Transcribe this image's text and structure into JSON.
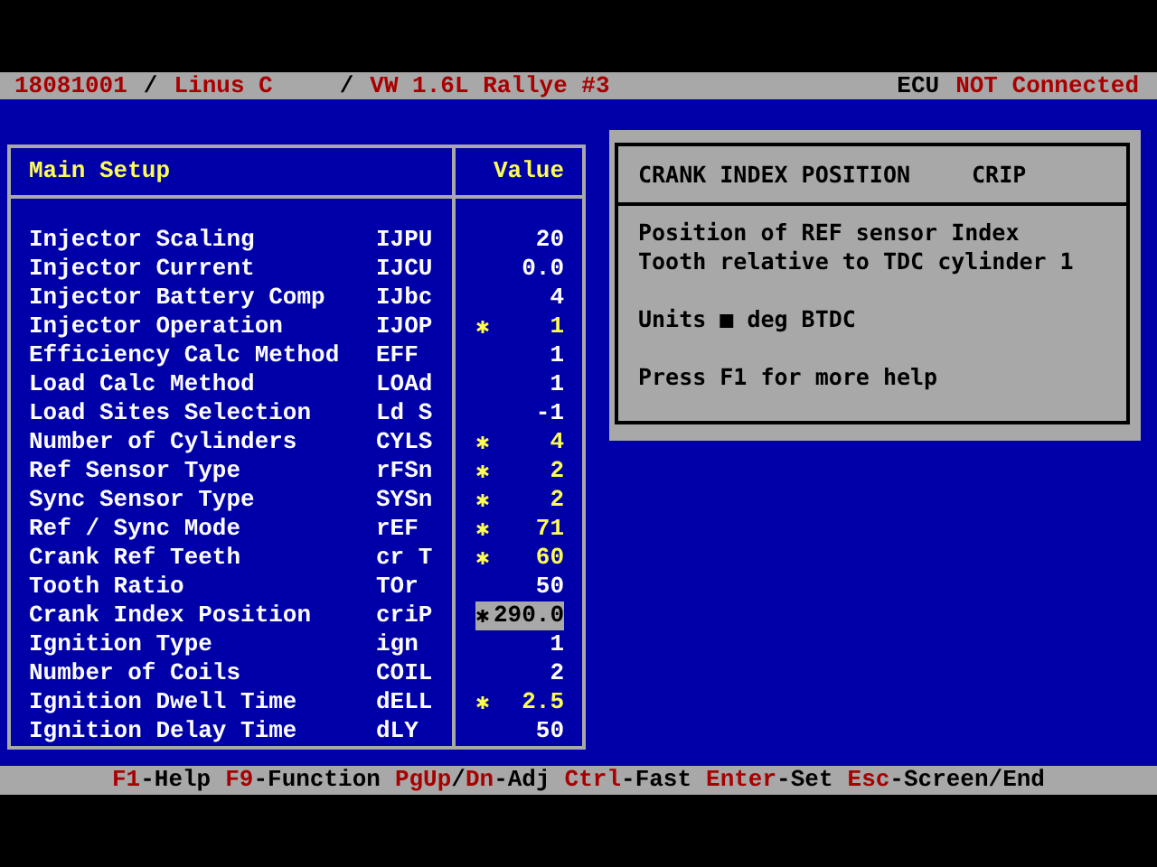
{
  "header": {
    "left": [
      {
        "text": "18081001",
        "kind": "field"
      },
      {
        "text": "/",
        "kind": "sep"
      },
      {
        "text": "Linus C",
        "kind": "field"
      },
      {
        "text": "/",
        "kind": "sep"
      },
      {
        "text": "VW 1.6L Rallye #3",
        "kind": "field"
      }
    ],
    "right": [
      {
        "text": "ECU",
        "kind": "sep"
      },
      {
        "text": "NOT Connected",
        "kind": "field"
      }
    ]
  },
  "table": {
    "title": "Main Setup",
    "value_heading": "Value",
    "rows": [
      {
        "label": "Injector Scaling",
        "code": "IJPU",
        "value": "20",
        "modified": false,
        "selected": false
      },
      {
        "label": "Injector Current",
        "code": "IJCU",
        "value": "0.0",
        "modified": false,
        "selected": false
      },
      {
        "label": "Injector Battery Comp",
        "code": "IJbc",
        "value": "4",
        "modified": false,
        "selected": false
      },
      {
        "label": "Injector Operation",
        "code": "IJOP",
        "value": "1",
        "modified": true,
        "selected": false
      },
      {
        "label": "Efficiency Calc Method",
        "code": "EFF",
        "value": "1",
        "modified": false,
        "selected": false
      },
      {
        "label": "Load Calc Method",
        "code": "LOAd",
        "value": "1",
        "modified": false,
        "selected": false
      },
      {
        "label": "Load Sites Selection",
        "code": "Ld S",
        "value": "-1",
        "modified": false,
        "selected": false
      },
      {
        "label": "Number of Cylinders",
        "code": "CYLS",
        "value": "4",
        "modified": true,
        "selected": false
      },
      {
        "label": "Ref Sensor Type",
        "code": "rFSn",
        "value": "2",
        "modified": true,
        "selected": false
      },
      {
        "label": "Sync Sensor Type",
        "code": "SYSn",
        "value": "2",
        "modified": true,
        "selected": false
      },
      {
        "label": "Ref / Sync Mode",
        "code": "rEF",
        "value": "71",
        "modified": true,
        "selected": false
      },
      {
        "label": "Crank Ref Teeth",
        "code": "cr T",
        "value": "60",
        "modified": true,
        "selected": false
      },
      {
        "label": "Tooth Ratio",
        "code": "TOr",
        "value": "50",
        "modified": false,
        "selected": false
      },
      {
        "label": "Crank Index Position",
        "code": "criP",
        "value": "290.0",
        "modified": true,
        "selected": true
      },
      {
        "label": "Ignition Type",
        "code": "ign",
        "value": "1",
        "modified": false,
        "selected": false
      },
      {
        "label": "Number of Coils",
        "code": "COIL",
        "value": "2",
        "modified": false,
        "selected": false
      },
      {
        "label": "Ignition Dwell Time",
        "code": "dELL",
        "value": "2.5",
        "modified": true,
        "selected": false
      },
      {
        "label": "Ignition Delay Time",
        "code": "dLY",
        "value": "50",
        "modified": false,
        "selected": false
      }
    ]
  },
  "help": {
    "title": "CRANK INDEX POSITION",
    "code": "CRIP",
    "paragraphs": [
      [
        "Position of REF sensor Index",
        "Tooth relative to TDC cylinder 1"
      ],
      [
        "Units ■ deg BTDC"
      ],
      [
        "Press F1 for more help"
      ]
    ]
  },
  "footer": [
    [
      {
        "text": "F1",
        "kind": "key"
      },
      {
        "text": "-Help",
        "kind": "desc"
      }
    ],
    [
      {
        "text": "F9",
        "kind": "key"
      },
      {
        "text": "-Function",
        "kind": "desc"
      }
    ],
    [
      {
        "text": "PgUp",
        "kind": "key"
      },
      {
        "text": "/",
        "kind": "desc"
      },
      {
        "text": "Dn",
        "kind": "key"
      },
      {
        "text": "-Adj",
        "kind": "desc"
      }
    ],
    [
      {
        "text": "Ctrl",
        "kind": "key"
      },
      {
        "text": "-Fast",
        "kind": "desc"
      }
    ],
    [
      {
        "text": "Enter",
        "kind": "key"
      },
      {
        "text": "-Set",
        "kind": "desc"
      }
    ],
    [
      {
        "text": "Esc",
        "kind": "key"
      },
      {
        "text": "-Screen/End",
        "kind": "desc"
      }
    ]
  ]
}
